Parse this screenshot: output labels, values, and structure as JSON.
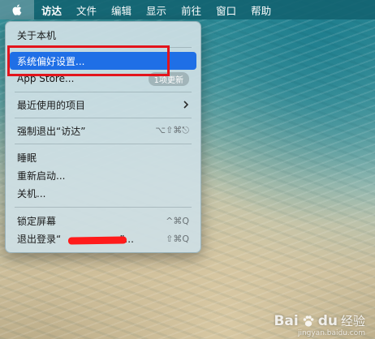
{
  "menubar": {
    "apple_icon": "apple-logo-icon",
    "menus": [
      {
        "label": "访达",
        "bold": true
      },
      {
        "label": "文件"
      },
      {
        "label": "编辑"
      },
      {
        "label": "显示"
      },
      {
        "label": "前往"
      },
      {
        "label": "窗口"
      },
      {
        "label": "帮助"
      }
    ]
  },
  "apple_menu": {
    "items": {
      "about": "关于本机",
      "system_prefs": "系统偏好设置...",
      "app_store": "App Store...",
      "app_store_badge": "1项更新",
      "recent_items": "最近使用的项目",
      "force_quit": "强制退出“访达”",
      "force_quit_shortcut": "⌥⇧⌘⎋",
      "sleep": "睡眠",
      "restart": "重新启动...",
      "shutdown": "关机...",
      "lock_screen": "锁定屏幕",
      "lock_shortcut": "^⌘Q",
      "logout_prefix": "退出登录“",
      "logout_suffix": "”...",
      "logout_shortcut": "⇧⌘Q"
    },
    "selected": "system_prefs"
  },
  "colors": {
    "selection": "#1f6fe6",
    "annotation_box": "#e3141c",
    "redaction": "#ff1b1b"
  },
  "watermark": {
    "brand": "Bai",
    "paw_icon": "baidu-paw-icon",
    "brand2": "du",
    "sub": "经验",
    "url": "jingyan.baidu.com"
  }
}
